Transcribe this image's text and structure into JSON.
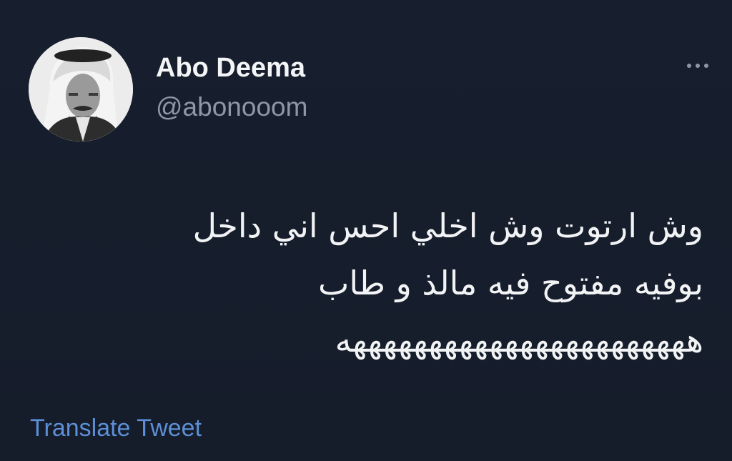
{
  "author": {
    "display_name": "Abo Deema",
    "handle": "@abonooom"
  },
  "tweet": {
    "lines": [
      "وش ارتوت وش اخلي احس اني داخل",
      "بوفيه مفتوح فيه مالذ و طاب",
      "هههههههههههههههههههههههه"
    ]
  },
  "actions": {
    "more_icon": "more-horizontal-icon",
    "translate_label": "Translate Tweet"
  },
  "colors": {
    "background": "#15202b",
    "primary_text": "#f2f3f5",
    "secondary_text": "#8e98a4",
    "link": "#5d8fd6"
  }
}
